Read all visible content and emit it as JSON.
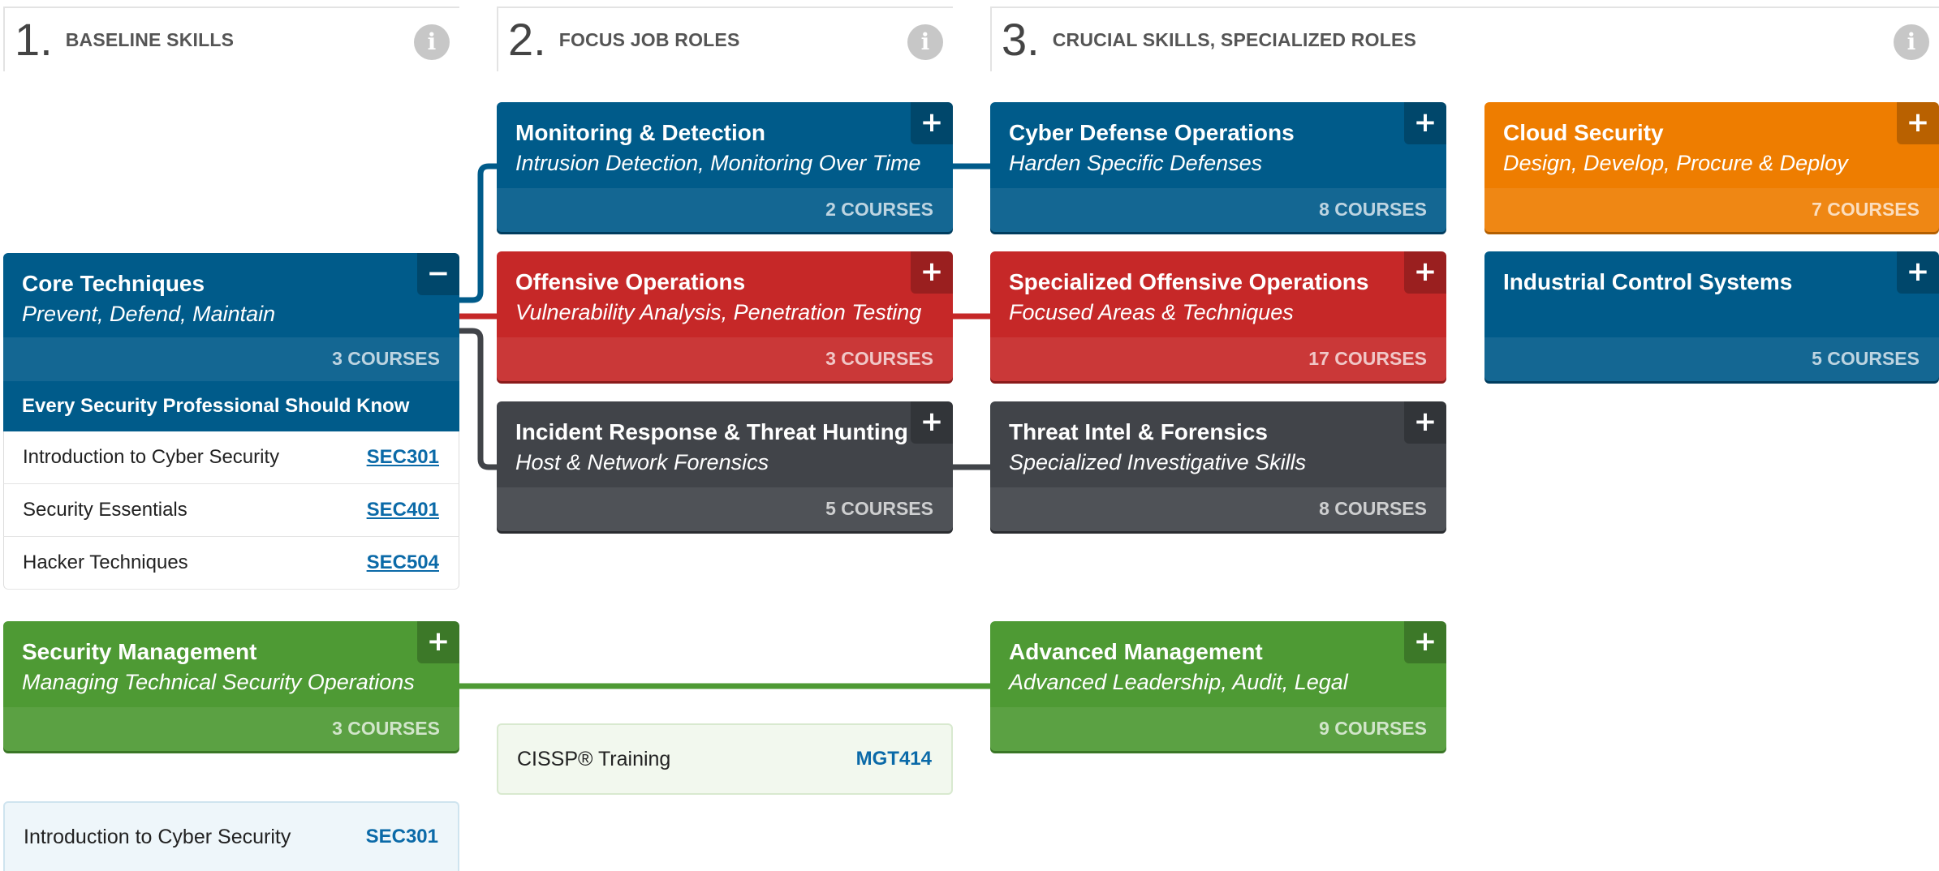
{
  "columns": [
    {
      "number": "1.",
      "title": "BASELINE SKILLS",
      "info_icon": "info-icon"
    },
    {
      "number": "2.",
      "title": "FOCUS JOB ROLES",
      "info_icon": "info-icon"
    },
    {
      "number": "3.",
      "title": "CRUCIAL SKILLS, SPECIALIZED ROLES",
      "info_icon": "info-icon"
    }
  ],
  "cards": {
    "core": {
      "title": "Core Techniques",
      "subtitle": "Prevent, Defend, Maintain",
      "count": "3 COURSES",
      "toggle": "−",
      "color": "#005b8a"
    },
    "monitoring": {
      "title": "Monitoring & Detection",
      "subtitle": "Intrusion Detection, Monitoring Over Time",
      "count": "2 COURSES",
      "toggle": "+",
      "color": "#005b8a"
    },
    "offensive": {
      "title": "Offensive Operations",
      "subtitle": "Vulnerability Analysis, Penetration Testing",
      "count": "3 COURSES",
      "toggle": "+",
      "color": "#c62828"
    },
    "incident": {
      "title": "Incident Response & Threat Hunting",
      "subtitle": "Host & Network Forensics",
      "count": "5 COURSES",
      "toggle": "+",
      "color": "#414449"
    },
    "cyber_defense": {
      "title": "Cyber Defense Operations",
      "subtitle": "Harden Specific Defenses",
      "count": "8 COURSES",
      "toggle": "+",
      "color": "#005b8a"
    },
    "spec_offensive": {
      "title": "Specialized Offensive Operations",
      "subtitle": "Focused Areas & Techniques",
      "count": "17 COURSES",
      "toggle": "+",
      "color": "#c62828"
    },
    "threat_intel": {
      "title": "Threat Intel & Forensics",
      "subtitle": "Specialized Investigative Skills",
      "count": "8 COURSES",
      "toggle": "+",
      "color": "#414449"
    },
    "cloud": {
      "title": "Cloud Security",
      "subtitle": "Design, Develop, Procure & Deploy",
      "count": "7 COURSES",
      "toggle": "+",
      "color": "#ee7d00"
    },
    "ics": {
      "title": "Industrial Control Systems",
      "subtitle": "",
      "count": "5 COURSES",
      "toggle": "+",
      "color": "#005b8a"
    },
    "sec_mgmt": {
      "title": "Security Management",
      "subtitle": "Managing Technical Security Operations",
      "count": "3 COURSES",
      "toggle": "+",
      "color": "#4e9a34"
    },
    "adv_mgmt": {
      "title": "Advanced Management",
      "subtitle": "Advanced Leadership, Audit, Legal",
      "count": "9 COURSES",
      "toggle": "+",
      "color": "#4e9a34"
    }
  },
  "core_expanded": {
    "heading": "Every Security Professional Should Know",
    "courses": [
      {
        "name": "Introduction to Cyber Security",
        "code": "SEC301"
      },
      {
        "name": "Security Essentials",
        "code": "SEC401"
      },
      {
        "name": "Hacker Techniques",
        "code": "SEC504"
      }
    ]
  },
  "extra_courses": {
    "cissp": {
      "name": "CISSP® Training",
      "code": "MGT414"
    },
    "intro": {
      "name": "Introduction to Cyber Security",
      "code": "SEC301"
    }
  }
}
